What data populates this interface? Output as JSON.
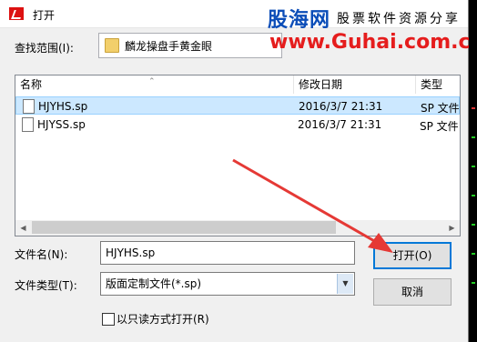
{
  "window": {
    "title": "打开"
  },
  "watermark": {
    "logo": "股海网",
    "tagline": "股票软件资源分享",
    "url": "www.Guhai.com.cn"
  },
  "lookin": {
    "label": "查找范围(I):",
    "value": "麟龙操盘手黄金眼"
  },
  "list": {
    "columns": [
      "名称",
      "修改日期",
      "类型"
    ],
    "rows": [
      {
        "name": "HJYHS.sp",
        "date": "2016/3/7 21:31",
        "type": "SP 文件",
        "selected": true
      },
      {
        "name": "HJYSS.sp",
        "date": "2016/3/7 21:31",
        "type": "SP 文件",
        "selected": false
      }
    ]
  },
  "filename": {
    "label": "文件名(N):",
    "value": "HJYHS.sp"
  },
  "filetype": {
    "label": "文件类型(T):",
    "value": "版面定制文件(*.sp)"
  },
  "buttons": {
    "open": "打开(O)",
    "cancel": "取消"
  },
  "readonly": {
    "label": "以只读方式打开(R)",
    "checked": false
  },
  "colors": {
    "selection": "#cce8ff",
    "accent": "#0078d7",
    "annotation_arrow": "#e53935"
  }
}
